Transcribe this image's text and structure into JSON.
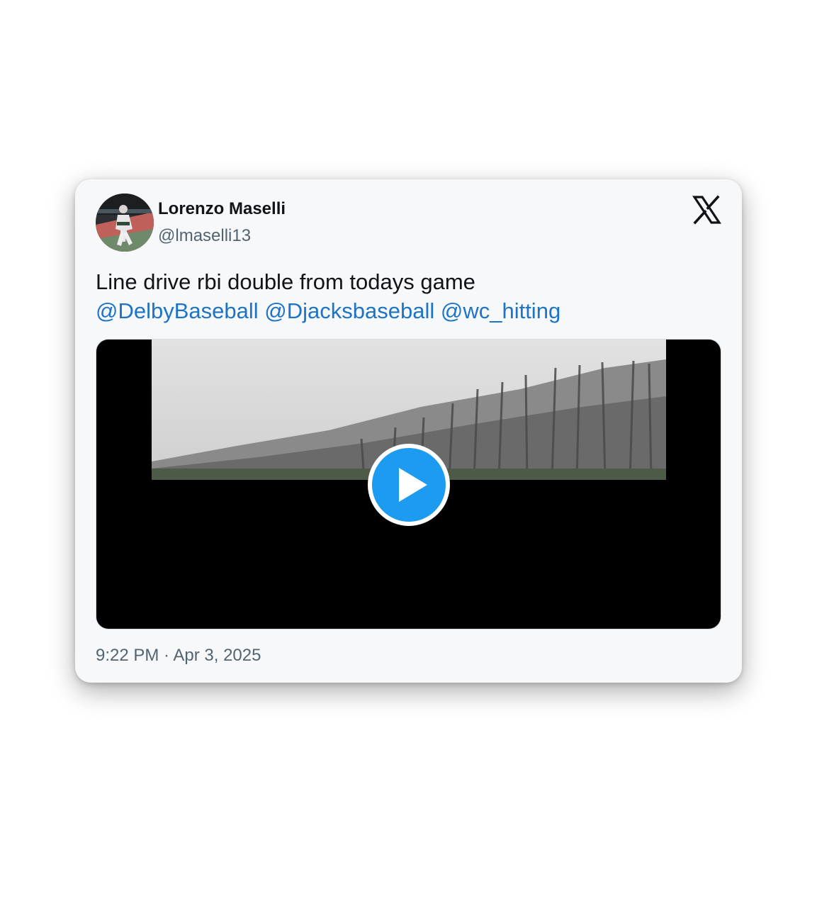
{
  "tweet": {
    "author": {
      "display_name": "Lorenzo Maselli",
      "handle": "@lmaselli13"
    },
    "text": "Line drive rbi double from todays game",
    "mentions": [
      "@DelbyBaseball",
      "@Djacksbaseball",
      "@wc_hitting"
    ],
    "timestamp": "9:22 PM · Apr 3, 2025"
  },
  "icons": {
    "platform_logo": "x-logo-icon",
    "play": "play-icon"
  },
  "colors": {
    "card_background": "#f7f8fa",
    "text_primary": "#0f1419",
    "text_secondary": "#536471",
    "mention": "#1d74c6",
    "play_button": "#1d9bf0",
    "media_background": "#000000"
  }
}
